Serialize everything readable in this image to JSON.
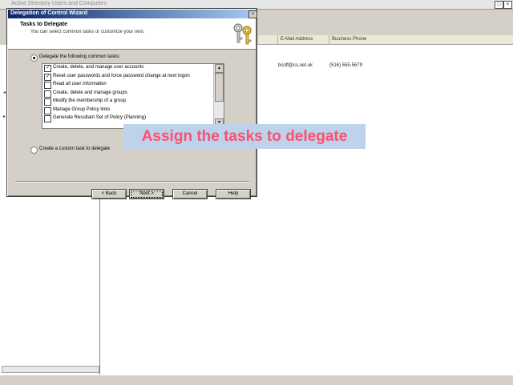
{
  "mmc": {
    "title": "Active Directory Users and Computers",
    "columns": [
      "E-Mail Address",
      "Business Phone"
    ],
    "row": {
      "email": "bcoff@cs.net.uk",
      "phone": "(516) 555-5679"
    },
    "max_glyph": "□",
    "close_glyph": "×"
  },
  "dialog": {
    "title": "Delegation of Control Wizard",
    "close_glyph": "×",
    "header_title": "Tasks to Delegate",
    "header_subtitle": "You can select common tasks or customize your own.",
    "radio_common_label": "Delegate the following common tasks:",
    "radio_custom_label": "Create a custom task to delegate",
    "tasks": [
      {
        "label": "Create, delete, and manage user accounts",
        "checked": true
      },
      {
        "label": "Reset user passwords and force password change at next logon",
        "checked": true
      },
      {
        "label": "Read all user information",
        "checked": false
      },
      {
        "label": "Create, delete and manage groups",
        "checked": false
      },
      {
        "label": "Modify the membership of a group",
        "checked": false
      },
      {
        "label": "Manage Group Policy links",
        "checked": false
      },
      {
        "label": "Generate Resultant Set of Policy (Planning)",
        "checked": false
      }
    ],
    "check_glyph": "✓",
    "buttons": {
      "back": "< Back",
      "next": "Next >",
      "cancel": "Cancel",
      "help": "Help"
    }
  },
  "overlay": {
    "text": "Assign the tasks to delegate"
  },
  "colors": {
    "title_start": "#0a246a",
    "title_end": "#a6caf0",
    "overlay_text": "#ff4f6e",
    "overlay_bg": "#bdd3ec"
  }
}
